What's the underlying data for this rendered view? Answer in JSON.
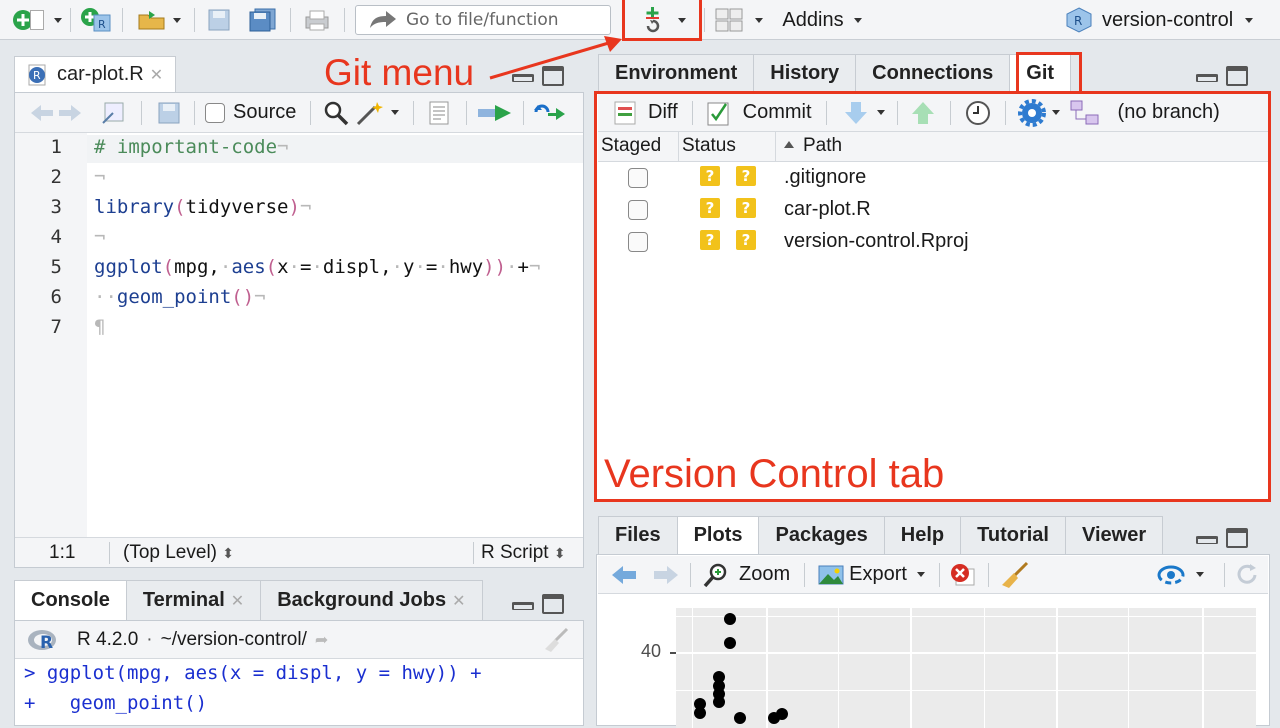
{
  "toolbar": {
    "goto_placeholder": "Go to file/function",
    "addins_label": "Addins",
    "project_label": "version-control"
  },
  "editor": {
    "tab_label": "car-plot.R",
    "source_label": "Source",
    "lines": [
      {
        "n": "1",
        "text": "# important-code"
      },
      {
        "n": "2",
        "text": ""
      },
      {
        "n": "3",
        "text": "library(tidyverse)"
      },
      {
        "n": "4",
        "text": ""
      },
      {
        "n": "5",
        "text": "ggplot(mpg, aes(x = displ, y = hwy)) +"
      },
      {
        "n": "6",
        "text": "  geom_point()"
      },
      {
        "n": "7",
        "text": ""
      }
    ],
    "status_pos": "1:1",
    "status_scope": "(Top Level)",
    "status_type": "R Script"
  },
  "console": {
    "tabs": [
      "Console",
      "Terminal",
      "Background Jobs"
    ],
    "r_version": "R 4.2.0",
    "path": "~/version-control/",
    "line1": "> ggplot(mpg, aes(x = displ, y = hwy)) +",
    "line2": "+   geom_point()"
  },
  "env_pane": {
    "tabs": [
      "Environment",
      "History",
      "Connections",
      "Git"
    ],
    "git_toolbar": {
      "diff_label": "Diff",
      "commit_label": "Commit",
      "branch_label": "(no branch)"
    },
    "columns": [
      "Staged",
      "Status",
      "Path"
    ],
    "files": [
      {
        "path": ".gitignore",
        "status1": "?",
        "status2": "?"
      },
      {
        "path": "car-plot.R",
        "status1": "?",
        "status2": "?"
      },
      {
        "path": "version-control.Rproj",
        "status1": "?",
        "status2": "?"
      }
    ]
  },
  "files_pane": {
    "tabs": [
      "Files",
      "Plots",
      "Packages",
      "Help",
      "Tutorial",
      "Viewer"
    ],
    "zoom_label": "Zoom",
    "export_label": "Export",
    "y_tick_40": "40"
  },
  "annotations": {
    "git_menu": "Git menu",
    "vc_tab": "Version Control tab"
  },
  "colors": {
    "annotation_red": "#e8361e",
    "status_yellow": "#f2c21b"
  }
}
